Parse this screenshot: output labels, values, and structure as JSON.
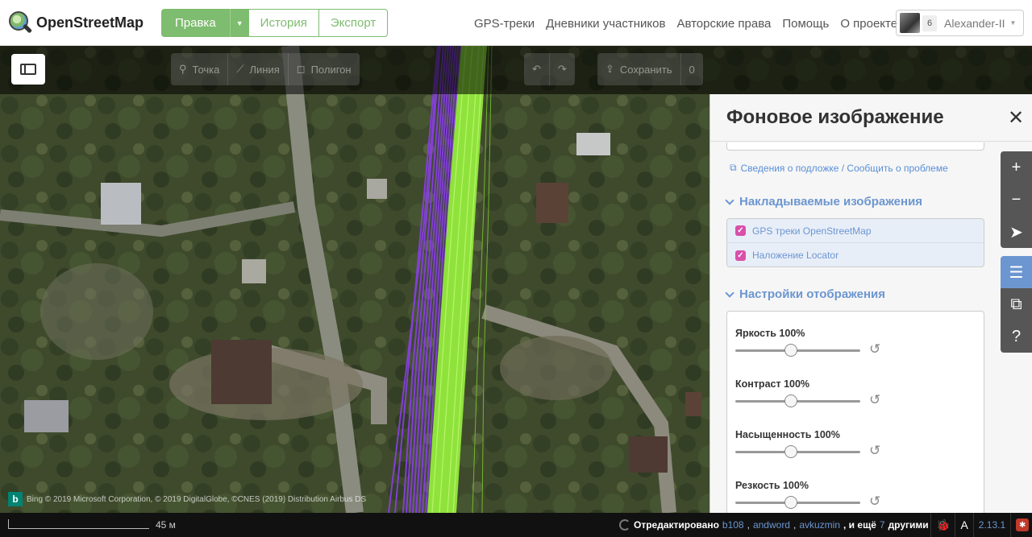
{
  "brand": {
    "name": "OpenStreetMap"
  },
  "header": {
    "edit_label": "Правка",
    "history_label": "История",
    "export_label": "Экспорт",
    "nav": [
      "GPS-треки",
      "Дневники участников",
      "Авторские права",
      "Помощь",
      "О проекте"
    ],
    "user": {
      "count": "6",
      "name": "Alexander-II"
    }
  },
  "toolbar": {
    "point_label": "Точка",
    "line_label": "Линия",
    "polygon_label": "Полигон",
    "save_label": "Сохранить",
    "save_count": "0"
  },
  "panel": {
    "title": "Фоновое изображение",
    "close_symbol": "✕",
    "info_link": "Сведения о подложке / Сообщить о проблеме",
    "overlays_heading": "Накладываемые изображения",
    "overlays": [
      {
        "label": "GPS треки OpenStreetMap",
        "checked": true
      },
      {
        "label": "Наложение Locator",
        "checked": true
      }
    ],
    "display_heading": "Настройки отображения",
    "adjustments": [
      {
        "label": "Яркость 100%",
        "value": 1.0
      },
      {
        "label": "Контраст 100%",
        "value": 1.0
      },
      {
        "label": "Насыщенность 100%",
        "value": 1.0
      },
      {
        "label": "Резкость 100%",
        "value": 1.0
      }
    ]
  },
  "map_controls": [
    "zoom-in-icon",
    "zoom-out-icon",
    "geolocate-icon",
    "layers-icon",
    "map-data-icon",
    "help-icon"
  ],
  "attribution": {
    "logo_letter": "b",
    "text": "Bing  © 2019 Microsoft Corporation, © 2019 DigitalGlobe, ©CNES (2019) Distribution Airbus DS"
  },
  "footer": {
    "scale": "45 м",
    "edited_prefix": "Отредактировано",
    "editors": [
      "b108",
      "andword",
      "avkuzmin"
    ],
    "tail": ", и ещё",
    "more_count": "7",
    "tail2": "другими",
    "version": "2.13.1"
  },
  "colors": {
    "osm_green": "#7ebc6f",
    "id_blue": "#6c96d0",
    "gps_purple": "#8a3ee8",
    "locator_green": "#8fe23b"
  }
}
